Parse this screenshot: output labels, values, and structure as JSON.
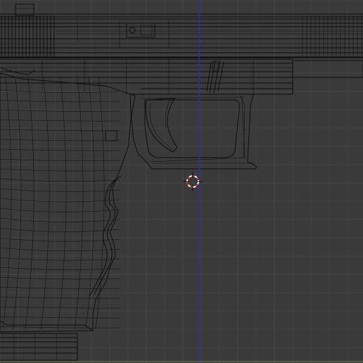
{
  "viewport": {
    "background": "#3a3a3a",
    "grid_color": "#444444",
    "view": "side-orthographic",
    "shading": "wireframe",
    "wire_color": "#101010",
    "z_axis_color": "#2b2bd8",
    "x_axis_color": "#5f8a3a"
  },
  "cursor": {
    "icon": "3d-cursor-icon",
    "ring_colors": [
      "#ffffff",
      "#c8302a"
    ]
  },
  "model": {
    "kind": "pistol-mesh",
    "parts": [
      "slide",
      "frame",
      "trigger-guard",
      "trigger",
      "grip",
      "magazine-baseplate"
    ]
  }
}
